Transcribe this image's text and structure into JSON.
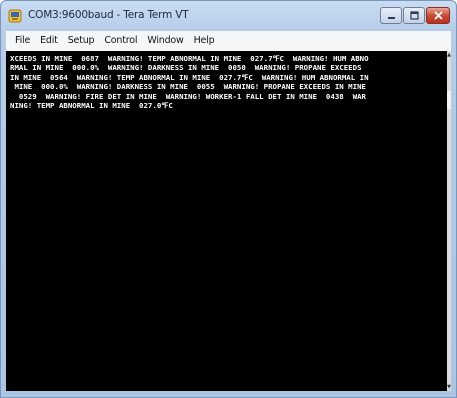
{
  "window": {
    "title": "COM3:9600baud - Tera Term VT"
  },
  "menu": {
    "items": [
      "File",
      "Edit",
      "Setup",
      "Control",
      "Window",
      "Help"
    ]
  },
  "terminal": {
    "lines": [
      "XCEEDS IN MINE  0687  WARNING! TEMP ABNORMAL IN MINE  027.7℉C  WARNING! HUM ABNO",
      "RMAL IN MINE  000.0%  WARNING! DARKNESS IN MINE  0050  WARNING! PROPANE EXCEEDS",
      "IN MINE  0564  WARNING! TEMP ABNORMAL IN MINE  027.7℉C  WARNING! HUM ABNORMAL IN",
      " MINE  000.0%  WARNING! DARKNESS IN MINE  0055  WARNING! PROPANE EXCEEDS IN MINE",
      "  0529  WARNING! FIRE DET IN MINE  WARNING! WORKER-1 FALL DET IN MINE  0438  WAR",
      "NING! TEMP ABNORMAL IN MINE  027.0℉C"
    ]
  },
  "colors": {
    "terminal_bg": "#000000",
    "terminal_fg": "#ffffff",
    "close_button": "#c7432f"
  }
}
